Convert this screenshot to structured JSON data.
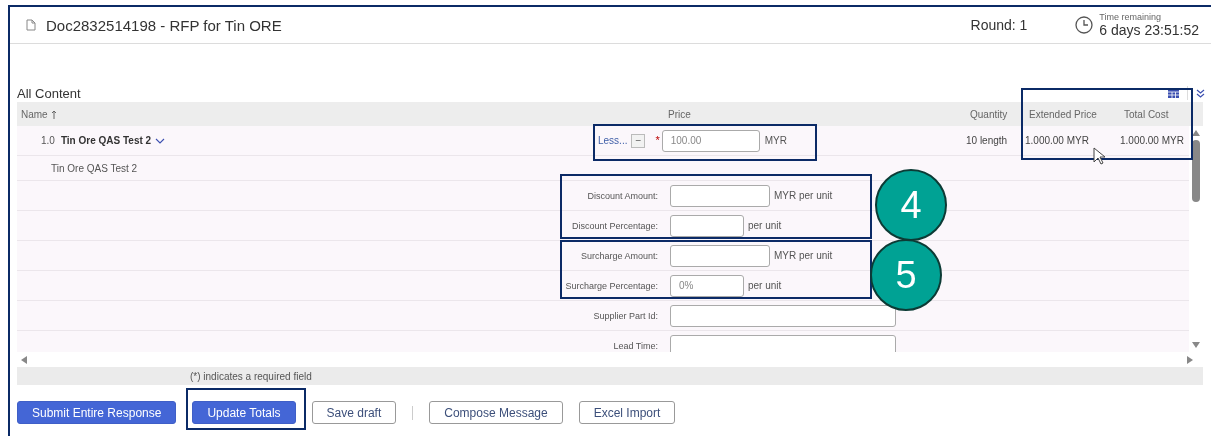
{
  "header": {
    "title": "Doc2832514198 - RFP for Tin ORE",
    "round": "Round: 1",
    "time_label": "Time remaining",
    "time_value": "6 days 23:51:52"
  },
  "section_title": "All Content",
  "columns": [
    "Name",
    "Price",
    "Quantity",
    "Extended Price",
    "Total Cost"
  ],
  "item": {
    "number": "1.0",
    "name": "Tin Ore QAS Test 2",
    "expanded": true,
    "less_link": "Less...",
    "collapse_symbol": "−",
    "price_required": true,
    "required_mark": "*",
    "price_value": "100.00",
    "price_currency": "MYR",
    "quantity": "10 length",
    "extended_price": "1.000.00 MYR",
    "total_cost": "1.000.00 MYR",
    "description": "Tin Ore QAS Test 2"
  },
  "fields": [
    {
      "label": "Discount Amount:",
      "kind": "medium",
      "unit": "MYR per unit"
    },
    {
      "label": "Discount Percentage:",
      "kind": "narrow",
      "unit": "per unit"
    },
    {
      "label": "Surcharge Amount:",
      "kind": "medium",
      "unit": "MYR per unit"
    },
    {
      "label": "Surcharge Percentage:",
      "kind": "narrow",
      "placeholder": "0%",
      "unit": "per unit"
    },
    {
      "label": "Supplier Part Id:",
      "kind": "wide"
    },
    {
      "label": "Lead Time:",
      "kind": "wide"
    }
  ],
  "required_note": "(*) indicates a required field",
  "buttons": [
    {
      "label": "Submit Entire Response",
      "kind": "primary",
      "divider_before": false
    },
    {
      "label": "Update Totals",
      "kind": "primary",
      "divider_before": false
    },
    {
      "label": "Save draft",
      "kind": "secondary",
      "divider_before": false
    },
    {
      "label": "Compose Message",
      "kind": "secondary",
      "divider_before": true
    },
    {
      "label": "Excel Import",
      "kind": "secondary",
      "divider_before": false
    }
  ],
  "callouts": [
    {
      "label": "4"
    },
    {
      "label": "5"
    }
  ]
}
